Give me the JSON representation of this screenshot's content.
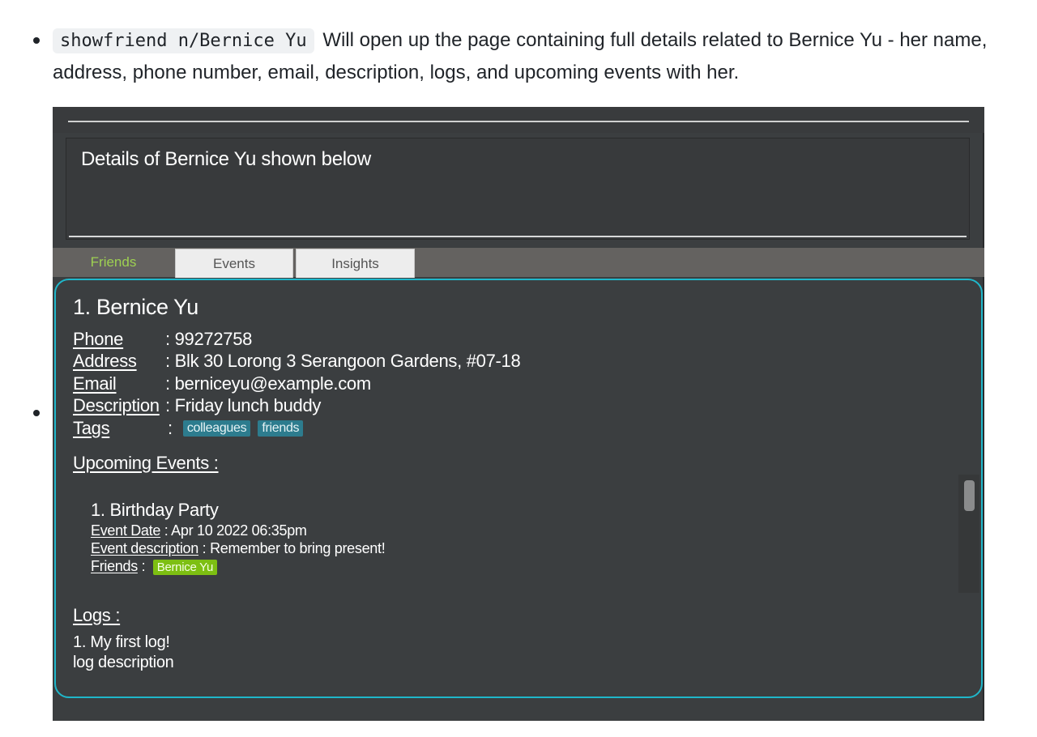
{
  "doc": {
    "command": "showfriend n/Bernice Yu",
    "description": "Will open up the page containing full details related to Bernice Yu - her name, address, phone number, email, description, logs, and upcoming events with her."
  },
  "app": {
    "result_message": "Details of Bernice Yu shown below",
    "tabs": [
      "Friends",
      "Events",
      "Insights"
    ],
    "friend": {
      "name": "1. Bernice Yu",
      "fields": [
        {
          "label": "Phone",
          "value": ": 99272758"
        },
        {
          "label": "Address",
          "value": ": Blk 30 Lorong 3 Serangoon Gardens, #07-18"
        },
        {
          "label": "Email",
          "value": ": berniceyu@example.com"
        },
        {
          "label": "Description",
          "value": ": Friday lunch buddy"
        },
        {
          "label": "Tags",
          "value": ":"
        }
      ],
      "tags": [
        "colleagues",
        "friends"
      ],
      "upcoming_events_heading": "Upcoming Events :",
      "event": {
        "title": "1.  Birthday Party",
        "date_label": "Event Date",
        "date_value": " : Apr 10 2022 06:35pm",
        "desc_label": "Event description",
        "desc_value": " : Remember to bring present!",
        "friends_label": "Friends",
        "friends_sep": " :  ",
        "friend_tag": "Bernice Yu"
      },
      "logs_heading": "Logs :",
      "log_title": "1. My first log!",
      "log_description": "log description"
    }
  },
  "colors": {
    "accent_border": "#1fb7ca",
    "tag_bg": "#2d7c8e",
    "friend_tag_bg": "#7dbf12",
    "active_tab_text": "#9ed052"
  }
}
